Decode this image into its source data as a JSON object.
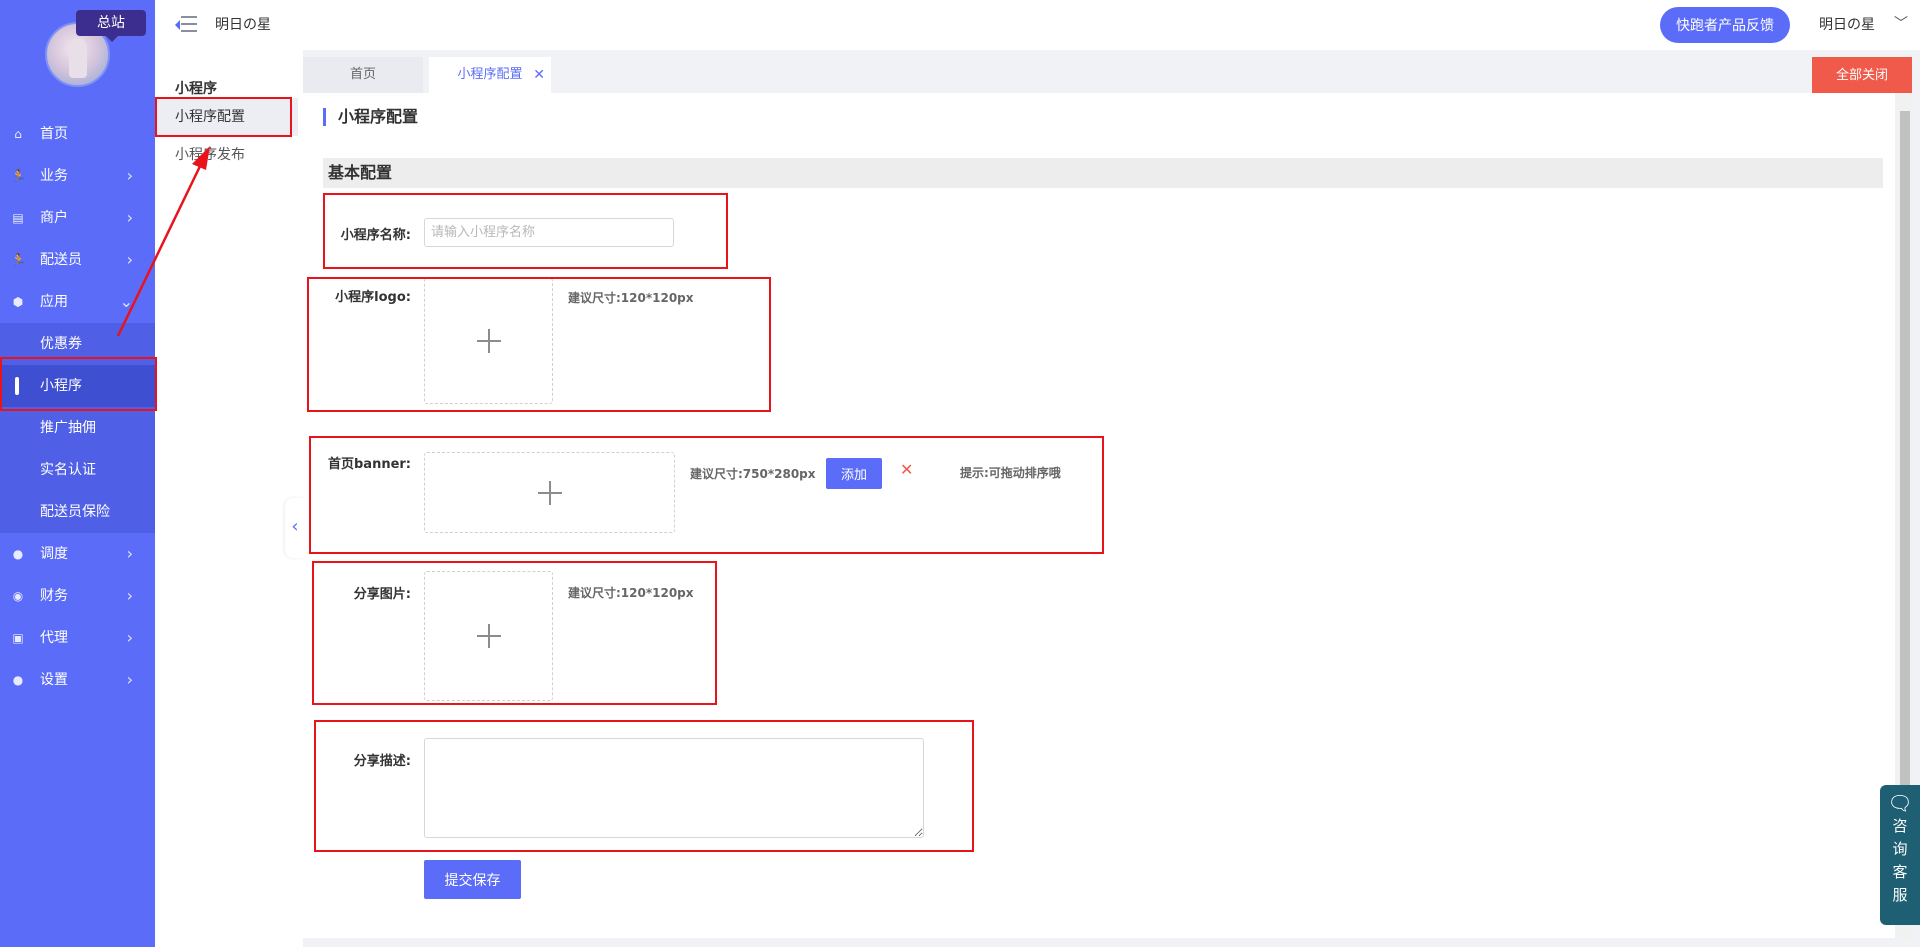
{
  "sidebar": {
    "station_badge": "总站",
    "menu": [
      {
        "label": "首页",
        "icon": "home-icon",
        "glyph": "⌂",
        "has_children": false
      },
      {
        "label": "业务",
        "icon": "runner-icon",
        "glyph": "🏃",
        "has_children": true
      },
      {
        "label": "商户",
        "icon": "store-icon",
        "glyph": "▤",
        "has_children": true
      },
      {
        "label": "配送员",
        "icon": "runner-icon",
        "glyph": "🏃",
        "has_children": true
      },
      {
        "label": "应用",
        "icon": "cube-icon",
        "glyph": "⬢",
        "has_children": true,
        "expanded": true
      }
    ],
    "submenu": [
      "优惠券",
      "小程序",
      "推广抽佣",
      "实名认证",
      "配送员保险"
    ],
    "submenu_active_index": 1,
    "menu_after": [
      {
        "label": "调度",
        "icon": "user-icon",
        "glyph": "●"
      },
      {
        "label": "财务",
        "icon": "coin-icon",
        "glyph": "◉"
      },
      {
        "label": "代理",
        "icon": "id-card-icon",
        "glyph": "▣"
      },
      {
        "label": "设置",
        "icon": "user-icon",
        "glyph": "●"
      }
    ],
    "colors": {
      "bg": "#5b6df8",
      "submenu_bg": "#4f5fe6",
      "active_bg": "#3f4fd2"
    }
  },
  "topbar": {
    "brand": "明日の星",
    "feedback_button": "快跑者产品反馈",
    "user_name": "明日の星",
    "user_chevron": "﹀"
  },
  "subnav": {
    "title": "小程序",
    "items": [
      "小程序配置",
      "小程序发布"
    ]
  },
  "tabs": {
    "home": "首页",
    "current": "小程序配置",
    "close_icon": "✕",
    "close_all": "全部关闭"
  },
  "content": {
    "page_title": "小程序配置",
    "section_title": "基本配置",
    "fields": {
      "name": {
        "label": "小程序名称:",
        "placeholder": "请输入小程序名称",
        "value": ""
      },
      "logo": {
        "label": "小程序logo:",
        "hint": "建议尺寸:120*120px"
      },
      "banner": {
        "label": "首页banner:",
        "hint": "建议尺寸:750*280px",
        "add_button": "添加",
        "delete_icon": "✕",
        "tip": "提示:可拖动排序哦"
      },
      "share_image": {
        "label": "分享图片:",
        "hint": "建议尺寸:120*120px"
      },
      "share_desc": {
        "label": "分享描述:",
        "value": ""
      }
    },
    "submit_button": "提交保存"
  },
  "consult_widget": {
    "text": "咨询客服"
  },
  "colors": {
    "accent": "#5b6df8",
    "danger": "#f05a4a",
    "annotation": "#e8131b",
    "consult": "#1e5f74"
  }
}
